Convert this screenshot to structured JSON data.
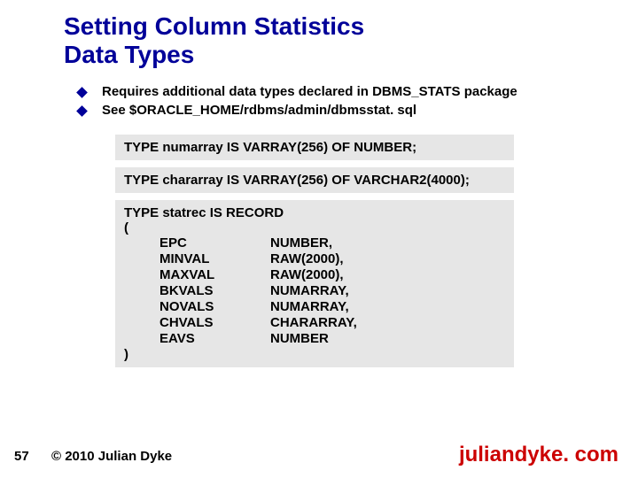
{
  "title": "Setting Column Statistics\nData Types",
  "bullets": [
    "Requires additional data types declared in DBMS_STATS package",
    "See $ORACLE_HOME/rdbms/admin/dbmsstat. sql"
  ],
  "code": {
    "numarray": "TYPE numarray IS VARRAY(256) OF NUMBER;",
    "chararray": "TYPE chararray IS VARRAY(256) OF VARCHAR2(4000);",
    "statrec_open": "TYPE statrec IS RECORD",
    "paren_open": "(",
    "paren_close": ")",
    "fields": [
      {
        "name": "EPC",
        "type": "NUMBER,"
      },
      {
        "name": "MINVAL",
        "type": "RAW(2000),"
      },
      {
        "name": "MAXVAL",
        "type": "RAW(2000),"
      },
      {
        "name": "BKVALS",
        "type": "NUMARRAY,"
      },
      {
        "name": "NOVALS",
        "type": "NUMARRAY,"
      },
      {
        "name": "CHVALS",
        "type": "CHARARRAY,"
      },
      {
        "name": "EAVS",
        "type": "NUMBER"
      }
    ]
  },
  "footer": {
    "page": "57",
    "copyright": "© 2010 Julian Dyke",
    "site": "juliandyke. com"
  }
}
